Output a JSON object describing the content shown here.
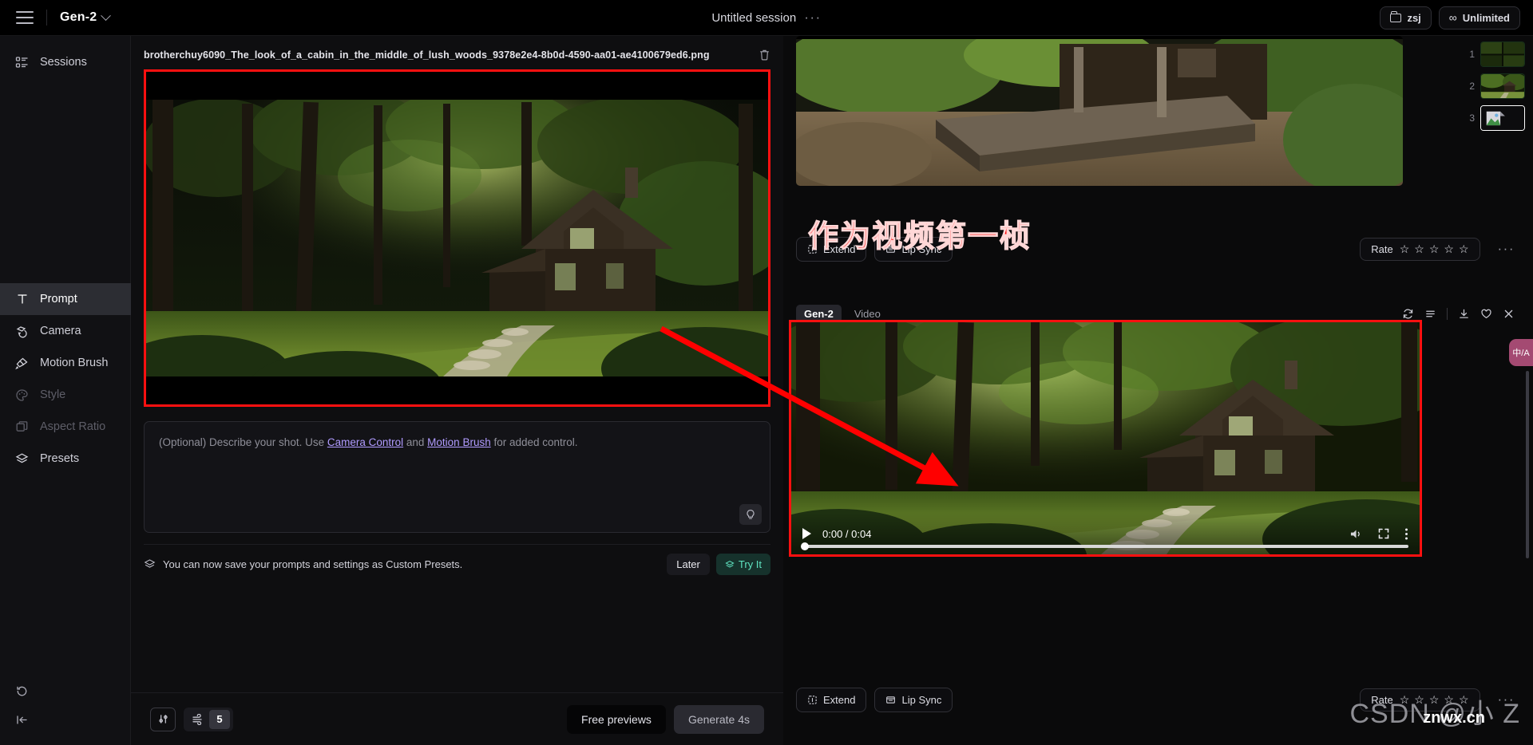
{
  "topbar": {
    "menu_icon": "hamburger-icon",
    "model": "Gen-2",
    "model_chevron": "chevron-down-icon",
    "session_title": "Untitled session",
    "session_more": "···",
    "workspace_label": "zsj",
    "workspace_icon": "folder-icon",
    "plan_label": "Unlimited",
    "plan_icon": "infinity-icon"
  },
  "sidebar": {
    "top_items": [
      {
        "label": "Sessions",
        "icon": "sessions-list-icon",
        "state": "enabled"
      }
    ],
    "tool_items": [
      {
        "label": "Prompt",
        "icon": "text-t-icon",
        "state": "active"
      },
      {
        "label": "Camera",
        "icon": "camera-orbit-icon",
        "state": "enabled"
      },
      {
        "label": "Motion Brush",
        "icon": "paint-brush-icon",
        "state": "enabled"
      },
      {
        "label": "Style",
        "icon": "palette-icon",
        "state": "disabled"
      },
      {
        "label": "Aspect Ratio",
        "icon": "aspect-ratio-icon",
        "state": "disabled"
      },
      {
        "label": "Presets",
        "icon": "layers-icon",
        "state": "enabled"
      }
    ],
    "bottom_items": [
      {
        "label": "",
        "icon": "undo-reset-icon",
        "state": "enabled"
      },
      {
        "label": "",
        "icon": "collapse-panel-icon",
        "state": "enabled"
      }
    ]
  },
  "left_panel": {
    "file_name": "brotherchuy6090_The_look_of_a_cabin_in_the_middle_of_lush_woods_9378e2e4-8b0d-4590-aa01-ae4100679ed6.png",
    "delete_icon": "trash-icon",
    "image_alt": "cabin in lush green woods with stone path",
    "prompt": {
      "value": "",
      "placeholder_prefix": "(Optional) Describe your shot. Use ",
      "link_1": "Camera Control",
      "placeholder_mid": " and ",
      "link_2": "Motion Brush",
      "placeholder_suffix": " for added control.",
      "idea_icon": "lightbulb-icon"
    },
    "preset_banner": {
      "icon": "layers-icon",
      "text": "You can now save your prompts and settings as Custom Presets.",
      "later_label": "Later",
      "try_label": "Try It",
      "try_icon": "layers-icon"
    },
    "bottom_bar": {
      "settings_icon": "sliders-icon",
      "motion_icon": "motion-wind-icon",
      "motion_value": "5",
      "free_previews_label": "Free previews",
      "generate_label": "Generate 4s"
    }
  },
  "right_panel": {
    "top_clip_alt": "cabin porch deck video frame",
    "top_actions": {
      "extend_label": "Extend",
      "extend_icon": "extend-icon",
      "lipsync_label": "Lip Sync",
      "lipsync_icon": "lip-sync-icon",
      "rate_label": "Rate",
      "rate_stars": 5,
      "rate_filled": 0,
      "star_icon": "star-outline-icon",
      "more_icon": "kebab-horizontal-icon"
    },
    "tabs": [
      {
        "label": "Gen-2",
        "active": true
      },
      {
        "label": "Video",
        "active": false
      }
    ],
    "tab_icons": [
      {
        "name": "regenerate-icon"
      },
      {
        "name": "list-menu-icon"
      },
      {
        "name": "download-icon"
      },
      {
        "name": "heart-icon"
      },
      {
        "name": "close-icon"
      }
    ],
    "player": {
      "play_icon": "play-icon",
      "current_time": "0:00",
      "separator": " / ",
      "duration": "0:04",
      "time_display": "0:00 / 0:04",
      "volume_icon": "volume-icon",
      "fullscreen_icon": "fullscreen-icon",
      "menu_icon": "kebab-vertical-icon",
      "progress_percent": 0,
      "media_alt": "generated video of cabin in lush woods"
    },
    "bottom_actions": {
      "extend_label": "Extend",
      "extend_icon": "extend-icon",
      "lipsync_label": "Lip Sync",
      "lipsync_icon": "lip-sync-icon",
      "rate_label": "Rate",
      "rate_stars": 5,
      "rate_filled": 0,
      "star_icon": "star-outline-icon",
      "more_icon": "kebab-horizontal-icon"
    }
  },
  "thumbnails": [
    {
      "number": "1",
      "selected": false,
      "kind": "grid-of-4"
    },
    {
      "number": "2",
      "selected": false,
      "kind": "cabin-photo"
    },
    {
      "number": "3",
      "selected": true,
      "kind": "image-placeholder"
    }
  ],
  "annotation": {
    "text": "作为视频第一桢",
    "color": "#ff0000",
    "arrow": "red-arrow-from-left-image-to-video"
  },
  "widgets": {
    "translate_label": "中/A",
    "translate_icon": "translate-icon"
  },
  "watermark": {
    "main": "CSDN @小 Z",
    "sub": "znwx.cn"
  },
  "colors": {
    "accent_red": "#ff1010",
    "accent_teal": "#5fe3c0",
    "link_purple": "#b09bff",
    "bg": "#0a0a0b",
    "panel": "#0e0e10",
    "rail": "#111114"
  }
}
